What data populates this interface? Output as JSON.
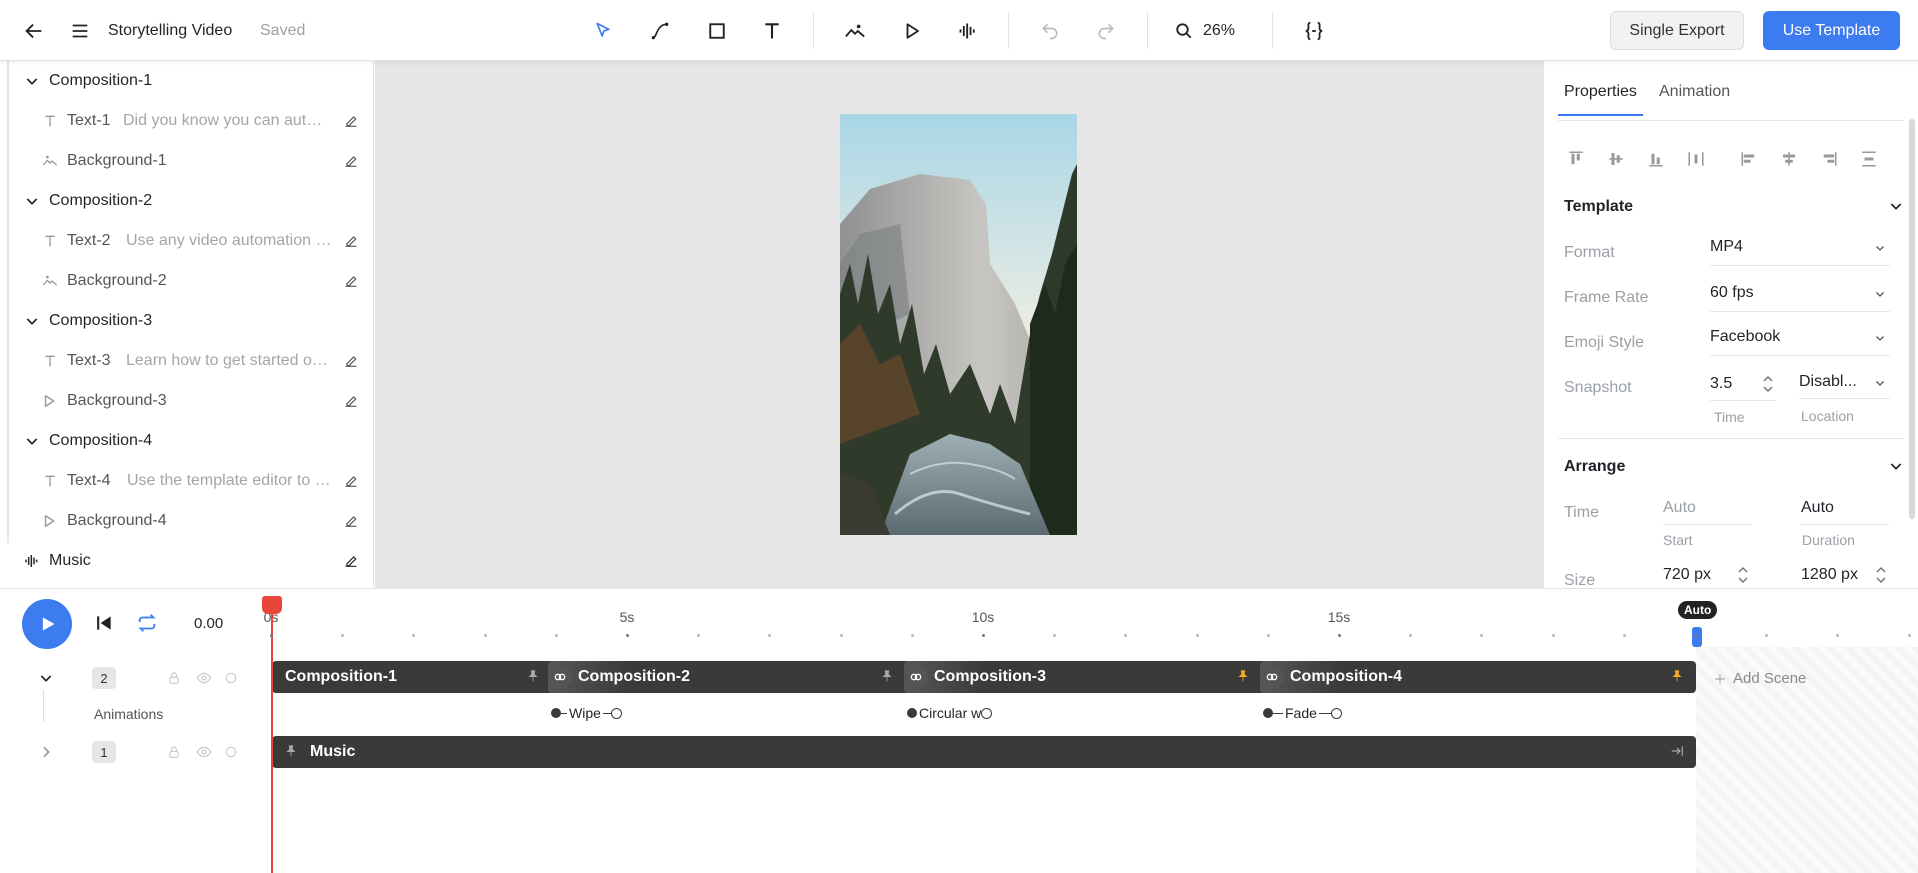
{
  "header": {
    "title": "Storytelling Video",
    "saved": "Saved",
    "zoom": "26%",
    "single_export": "Single Export",
    "use_template": "Use Template"
  },
  "tree": {
    "compositions": [
      {
        "label": "Composition-1",
        "text_name": "Text-1",
        "text_desc": "Did you know you can automate your videos?",
        "bg_name": "Background-1",
        "bg_icon": "image-icon"
      },
      {
        "label": "Composition-2",
        "text_name": "Text-2",
        "text_desc": "Use any video automation tool",
        "bg_name": "Background-2",
        "bg_icon": "image-icon"
      },
      {
        "label": "Composition-3",
        "text_name": "Text-3",
        "text_desc": "Learn how to get started online",
        "bg_name": "Background-3",
        "bg_icon": "video-icon"
      },
      {
        "label": "Composition-4",
        "text_name": "Text-4",
        "text_desc": "Use the template editor to design",
        "bg_name": "Background-4",
        "bg_icon": "video-icon"
      }
    ],
    "music": "Music"
  },
  "properties": {
    "tab_properties": "Properties",
    "tab_animation": "Animation",
    "template_section": "Template",
    "format_label": "Format",
    "format_value": "MP4",
    "frame_rate_label": "Frame Rate",
    "frame_rate_value": "60 fps",
    "emoji_label": "Emoji Style",
    "emoji_value": "Facebook",
    "snapshot_label": "Snapshot",
    "snapshot_time": "3.5",
    "snapshot_time_caption": "Time",
    "snapshot_location": "Disabl...",
    "snapshot_location_caption": "Location",
    "arrange_section": "Arrange",
    "time_label": "Time",
    "time_start": "Auto",
    "time_start_caption": "Start",
    "time_duration": "Auto",
    "time_duration_caption": "Duration",
    "size_label": "Size",
    "size_width": "720 px",
    "size_height": "1280 px"
  },
  "timeline": {
    "current_time": "0.00",
    "ruler_labels": [
      "0s",
      "5s",
      "10s",
      "15s"
    ],
    "auto_badge": "Auto",
    "track1_num": "2",
    "track2_num": "1",
    "animations_label": "Animations",
    "scenes": [
      "Composition-1",
      "Composition-2",
      "Composition-3",
      "Composition-4"
    ],
    "transitions": [
      "Wipe",
      "Circular wipe",
      "Fade"
    ],
    "music": "Music",
    "add_scene": "Add Scene"
  },
  "colors": {
    "accent": "#3d7bf0",
    "playhead": "#e8453c",
    "track": "#3a3a3a",
    "pin_highlight": "#f5a623"
  }
}
